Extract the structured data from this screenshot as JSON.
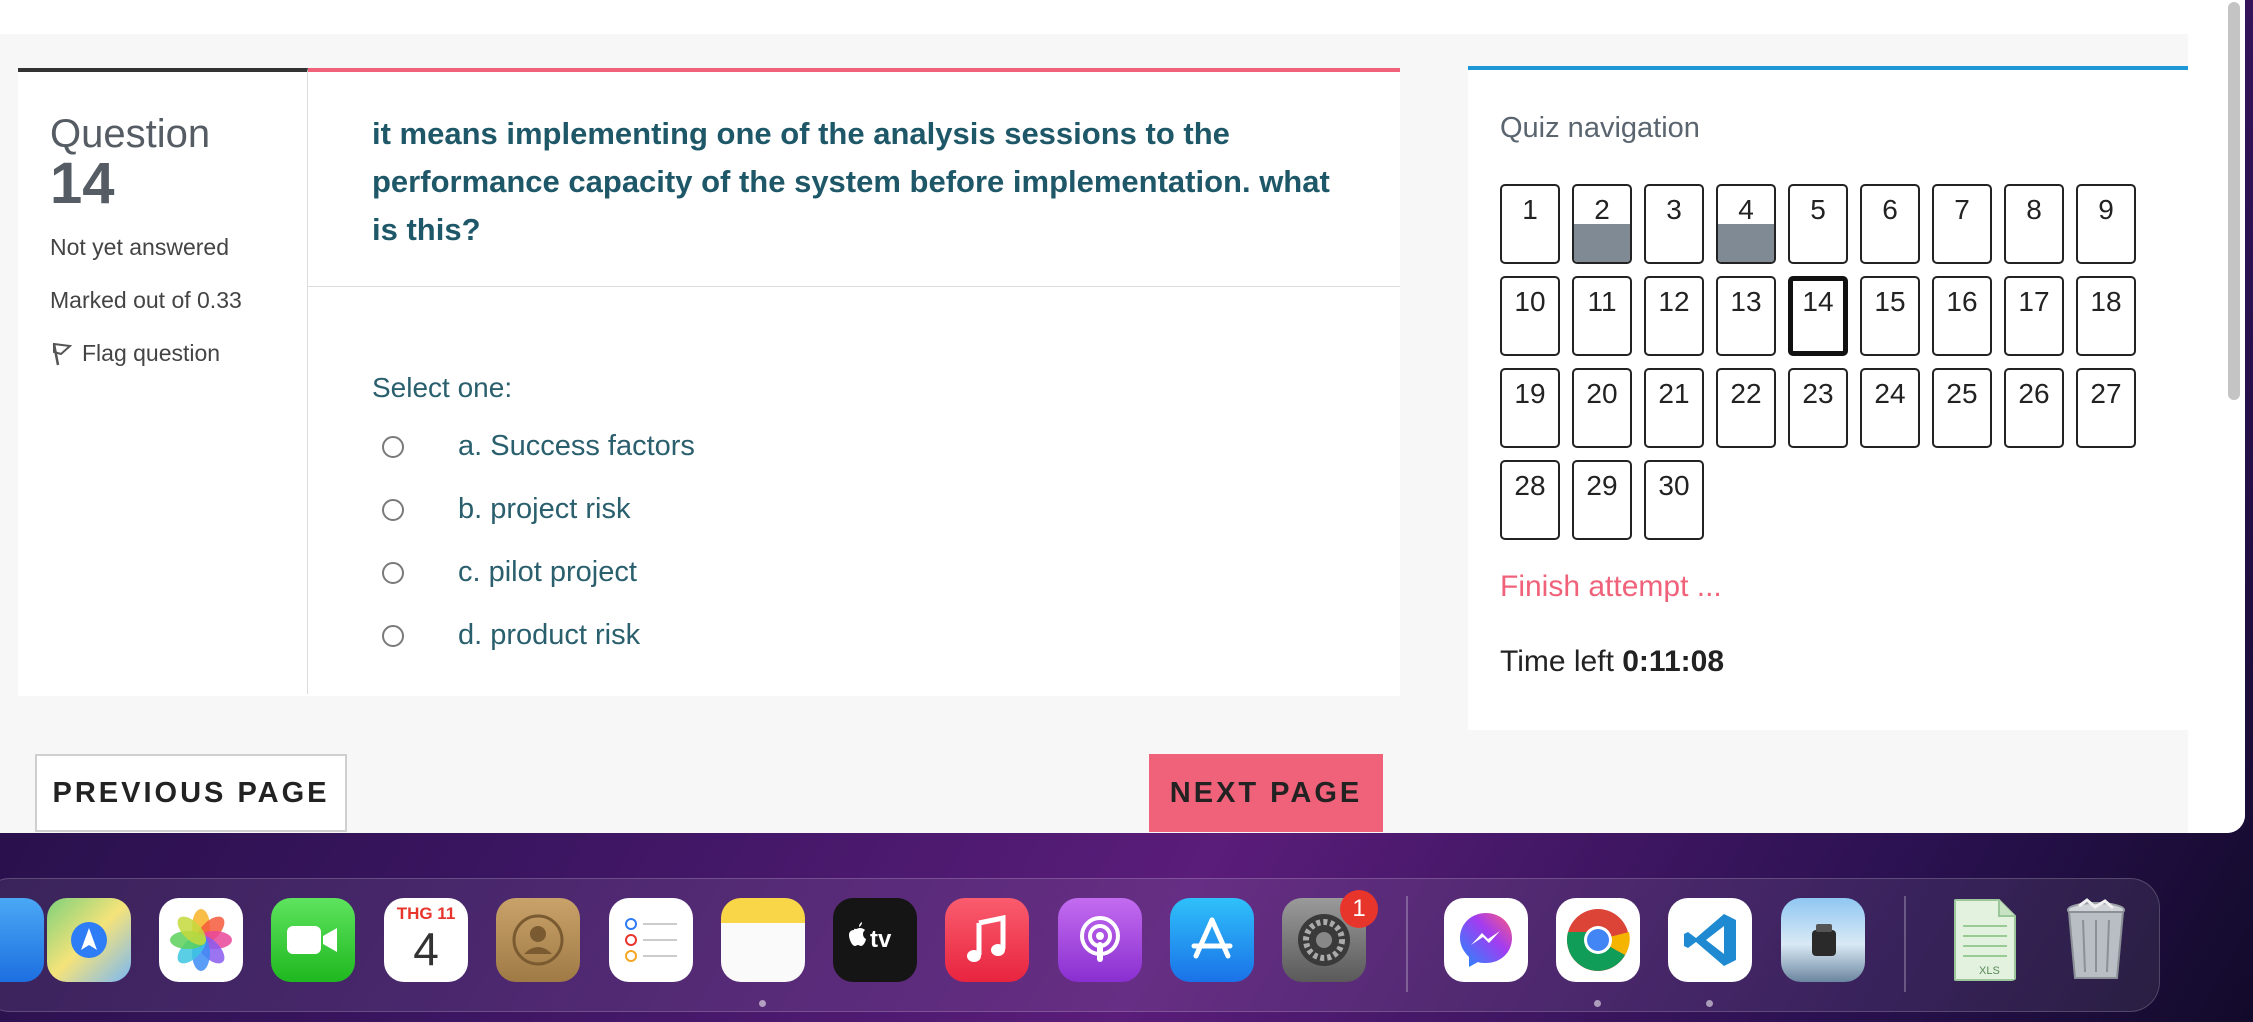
{
  "question": {
    "label": "Question",
    "number": "14",
    "status": "Not yet answered",
    "marked": "Marked out of 0.33",
    "flag_label": "Flag question",
    "text": "it means implementing one of the analysis sessions to the performance capacity of the system before implementation. what is this?",
    "select_label": "Select one:",
    "options": [
      "a. Success factors",
      "b. project risk",
      "c. pilot project",
      "d. product risk"
    ]
  },
  "buttons": {
    "previous": "PREVIOUS PAGE",
    "next": "NEXT PAGE"
  },
  "quiz_nav": {
    "title": "Quiz navigation",
    "items": [
      "1",
      "2",
      "3",
      "4",
      "5",
      "6",
      "7",
      "8",
      "9",
      "10",
      "11",
      "12",
      "13",
      "14",
      "15",
      "16",
      "17",
      "18",
      "19",
      "20",
      "21",
      "22",
      "23",
      "24",
      "25",
      "26",
      "27",
      "28",
      "29",
      "30"
    ],
    "answered": [
      "2",
      "4"
    ],
    "current": "14",
    "finish_label": "Finish attempt ...",
    "time_label": "Time left",
    "time_value": "0:11:08"
  },
  "dock": {
    "calendar_month": "THG 11",
    "calendar_day": "4",
    "settings_badge": "1",
    "apps": [
      "finder-icon",
      "maps-icon",
      "photos-icon",
      "facetime-icon",
      "calendar-icon",
      "contacts-icon",
      "reminders-icon",
      "notes-icon",
      "appletv-icon",
      "music-icon",
      "podcasts-icon",
      "appstore-icon",
      "settings-icon",
      "messenger-icon",
      "chrome-icon",
      "vscode-icon",
      "preview-icon",
      "excel-file-icon",
      "trash-icon"
    ]
  },
  "colors": {
    "accent_pink": "#f0627a",
    "accent_blue": "#1d97d5",
    "question_text": "#1e5868",
    "answered_fill": "#808a94"
  }
}
